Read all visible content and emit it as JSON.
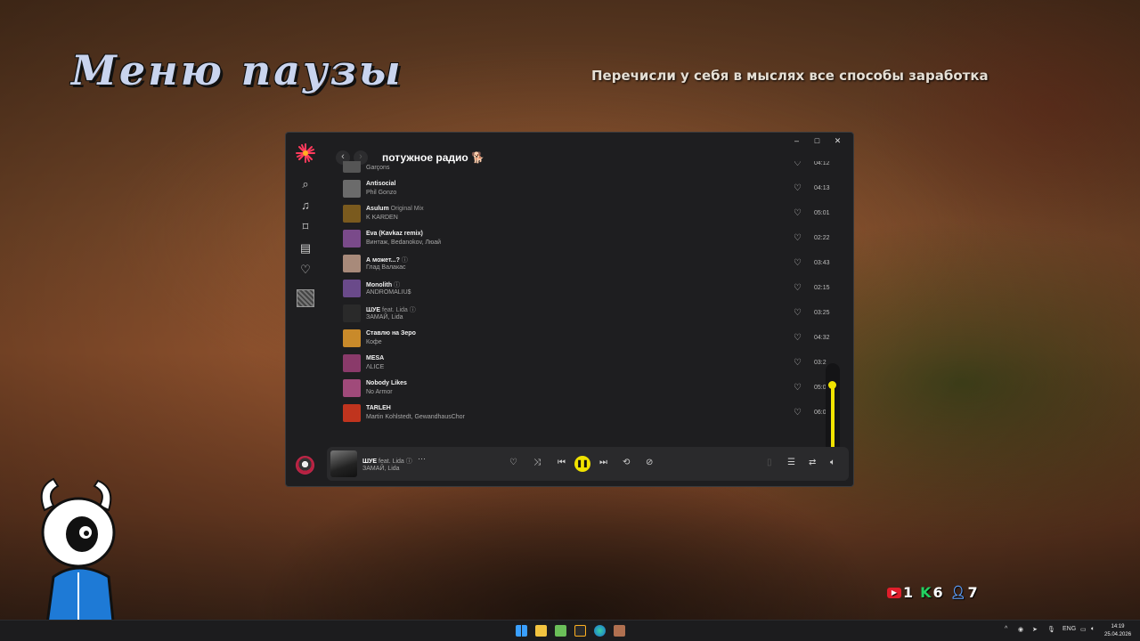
{
  "overlay": {
    "pause_title": "Меню паузы",
    "hint": "Перечисли у себя в мыслях все способы заработка"
  },
  "window": {
    "controls": {
      "minimize": "–",
      "maximize": "□",
      "close": "✕"
    },
    "nav": {
      "back": "‹",
      "forward": "›"
    },
    "playlist_title": "потужное радио 🐕"
  },
  "sidebar": {
    "icons": [
      "search-icon",
      "music-note-icon",
      "bookmark-icon",
      "library-icon",
      "heart-icon"
    ]
  },
  "tracks": [
    {
      "title": "",
      "extra": "",
      "artist": "Garçons",
      "duration": "04:12",
      "cover": "#555"
    },
    {
      "title": "Antisocial",
      "extra": "",
      "artist": "Phil Gonzo",
      "duration": "04:13",
      "cover": "#6b6b6b"
    },
    {
      "title": "Asulum",
      "extra": "Original Mix",
      "artist": "K KARDEN",
      "duration": "05:01",
      "cover": "#7a5a1e"
    },
    {
      "title": "Eva (Kavkaz remix)",
      "extra": "",
      "artist": "Винтаж, Bedanokov, Люай",
      "duration": "02:22",
      "cover": "#7a4a8a"
    },
    {
      "title": "А может...?",
      "extra": "ⓘ",
      "artist": "Глад Валакас",
      "duration": "03:43",
      "cover": "#a88a7a"
    },
    {
      "title": "Monolith",
      "extra": "ⓘ",
      "artist": "ANDROMALIU$",
      "duration": "02:15",
      "cover": "#6a4a8a"
    },
    {
      "title": "ШУЕ",
      "extra": "feat. Lida ⓘ",
      "artist": "ЗАМАЙ, Lida",
      "duration": "03:25",
      "cover": "#2a2a2a"
    },
    {
      "title": "Ставлю на Зеро",
      "extra": "",
      "artist": "Кофе",
      "duration": "04:32",
      "cover": "#c98a2a"
    },
    {
      "title": "MESA",
      "extra": "",
      "artist": "ΛLICE",
      "duration": "03:2",
      "cover": "#8a3a6a"
    },
    {
      "title": "Nobody Likes",
      "extra": "",
      "artist": "No Armor",
      "duration": "05:0",
      "cover": "#a04a7a"
    },
    {
      "title": "TARLEH",
      "extra": "",
      "artist": "Martin Kohlstedt, GewandhausChor",
      "duration": "06:0",
      "cover": "#c0341e"
    }
  ],
  "player": {
    "title": "ШУЕ",
    "extra": "feat. Lida ⓘ",
    "artist": "ЗАМАЙ, Lida",
    "more": "···",
    "play_state": "pause",
    "volume_level": 0.95,
    "accent": "#f0e200"
  },
  "counters": {
    "youtube": "1",
    "k": "6",
    "people": "7"
  },
  "taskbar": {
    "lang": "ENG",
    "time": "14:19",
    "date": "25.04.2026"
  }
}
